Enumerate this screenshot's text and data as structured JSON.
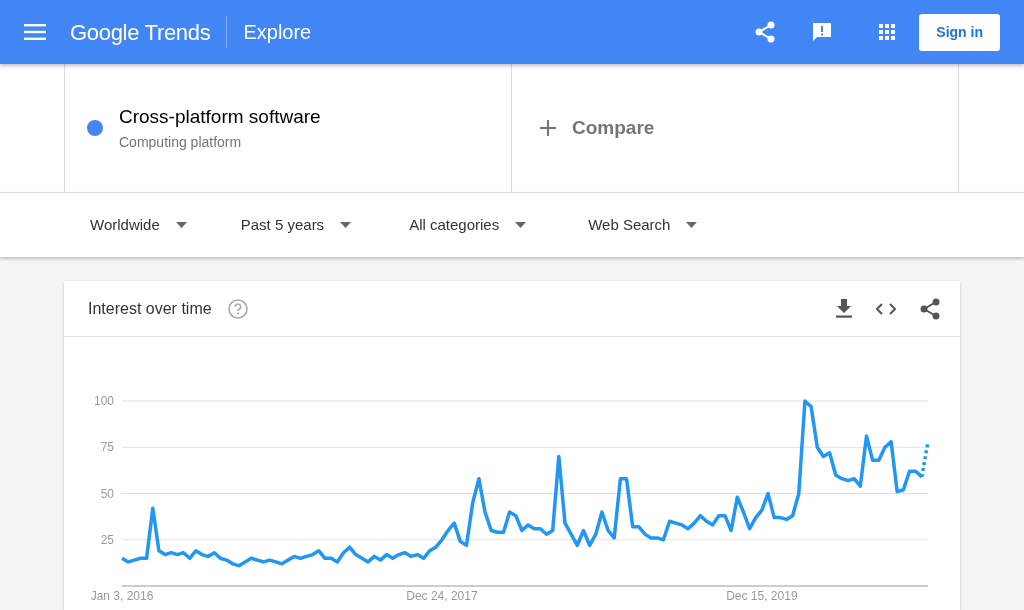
{
  "header": {
    "logo": "Google Trends",
    "page_title": "Explore",
    "sign_in": "Sign in"
  },
  "search_terms": [
    {
      "term": "Cross-platform software",
      "subtitle": "Computing platform",
      "color": "#4285f4"
    }
  ],
  "compare": {
    "label": "Compare"
  },
  "filters": [
    {
      "label": "Worldwide"
    },
    {
      "label": "Past 5 years"
    },
    {
      "label": "All categories"
    },
    {
      "label": "Web Search"
    }
  ],
  "interest_card": {
    "title": "Interest over time",
    "chart_data": {
      "type": "line",
      "grid": true,
      "ylim": [
        0,
        100
      ],
      "yticks": [
        25,
        50,
        75,
        100
      ],
      "categories": [
        "Jan 3, 2016",
        null,
        null,
        null,
        null,
        null,
        null,
        null,
        null,
        null,
        null,
        null,
        null,
        null,
        null,
        null,
        null,
        null,
        null,
        null,
        null,
        null,
        null,
        null,
        null,
        null,
        null,
        null,
        null,
        null,
        null,
        null,
        null,
        null,
        null,
        null,
        null,
        null,
        null,
        null,
        null,
        null,
        null,
        null,
        null,
        null,
        null,
        null,
        null,
        null,
        null,
        null,
        "Dec 24, 2017",
        null,
        null,
        null,
        null,
        null,
        null,
        null,
        null,
        null,
        null,
        null,
        null,
        null,
        null,
        null,
        null,
        null,
        null,
        null,
        null,
        null,
        null,
        null,
        null,
        null,
        null,
        null,
        null,
        null,
        null,
        null,
        null,
        null,
        null,
        null,
        null,
        null,
        null,
        null,
        null,
        null,
        null,
        null,
        null,
        null,
        null,
        null,
        null,
        null,
        null,
        null,
        "Dec 15, 2019",
        null,
        null,
        null,
        null,
        null,
        null,
        null,
        null,
        null,
        null,
        null,
        null,
        null,
        null,
        null,
        null,
        null,
        null,
        null,
        null,
        null,
        null,
        null,
        null,
        null,
        null,
        null
      ],
      "series": [
        {
          "color": "#2196f3",
          "line_style": "solid",
          "values": [
            15,
            13,
            14,
            15,
            15,
            42,
            19,
            17,
            18,
            17,
            18,
            15,
            19,
            17,
            16,
            18,
            15,
            14,
            12,
            11,
            13,
            15,
            14,
            13,
            14,
            13,
            12,
            14,
            16,
            15,
            16,
            17,
            19,
            15,
            15,
            13,
            18,
            21,
            17,
            15,
            13,
            16,
            14,
            17,
            15,
            17,
            18,
            16,
            17,
            15,
            19,
            21,
            25,
            30,
            34,
            24,
            22,
            45,
            58,
            40,
            30,
            29,
            29,
            40,
            38,
            30,
            33,
            31,
            31,
            28,
            30,
            70,
            34,
            28,
            22,
            30,
            22,
            28,
            40,
            30,
            26,
            58,
            58,
            32,
            32,
            28,
            26,
            26,
            25,
            35,
            34,
            33,
            31,
            34,
            38,
            35,
            33,
            38,
            38,
            30,
            48,
            40,
            31,
            37,
            41,
            50,
            37,
            37,
            36,
            38,
            50,
            100,
            97,
            75,
            70,
            72,
            60,
            58,
            57,
            58,
            54,
            81,
            68,
            68,
            75,
            78,
            51,
            52,
            62,
            62,
            59,
            null
          ]
        },
        {
          "color": "#2196f3",
          "line_style": "dotted",
          "values": [
            null,
            null,
            null,
            null,
            null,
            null,
            null,
            null,
            null,
            null,
            null,
            null,
            null,
            null,
            null,
            null,
            null,
            null,
            null,
            null,
            null,
            null,
            null,
            null,
            null,
            null,
            null,
            null,
            null,
            null,
            null,
            null,
            null,
            null,
            null,
            null,
            null,
            null,
            null,
            null,
            null,
            null,
            null,
            null,
            null,
            null,
            null,
            null,
            null,
            null,
            null,
            null,
            null,
            null,
            null,
            null,
            null,
            null,
            null,
            null,
            null,
            null,
            null,
            null,
            null,
            null,
            null,
            null,
            null,
            null,
            null,
            null,
            null,
            null,
            null,
            null,
            null,
            null,
            null,
            null,
            null,
            null,
            null,
            null,
            null,
            null,
            null,
            null,
            null,
            null,
            null,
            null,
            null,
            null,
            null,
            null,
            null,
            null,
            null,
            null,
            null,
            null,
            null,
            null,
            null,
            null,
            null,
            null,
            null,
            null,
            null,
            null,
            null,
            null,
            null,
            null,
            null,
            null,
            null,
            null,
            null,
            null,
            null,
            null,
            null,
            null,
            null,
            null,
            null,
            null,
            59,
            78
          ]
        }
      ]
    }
  }
}
